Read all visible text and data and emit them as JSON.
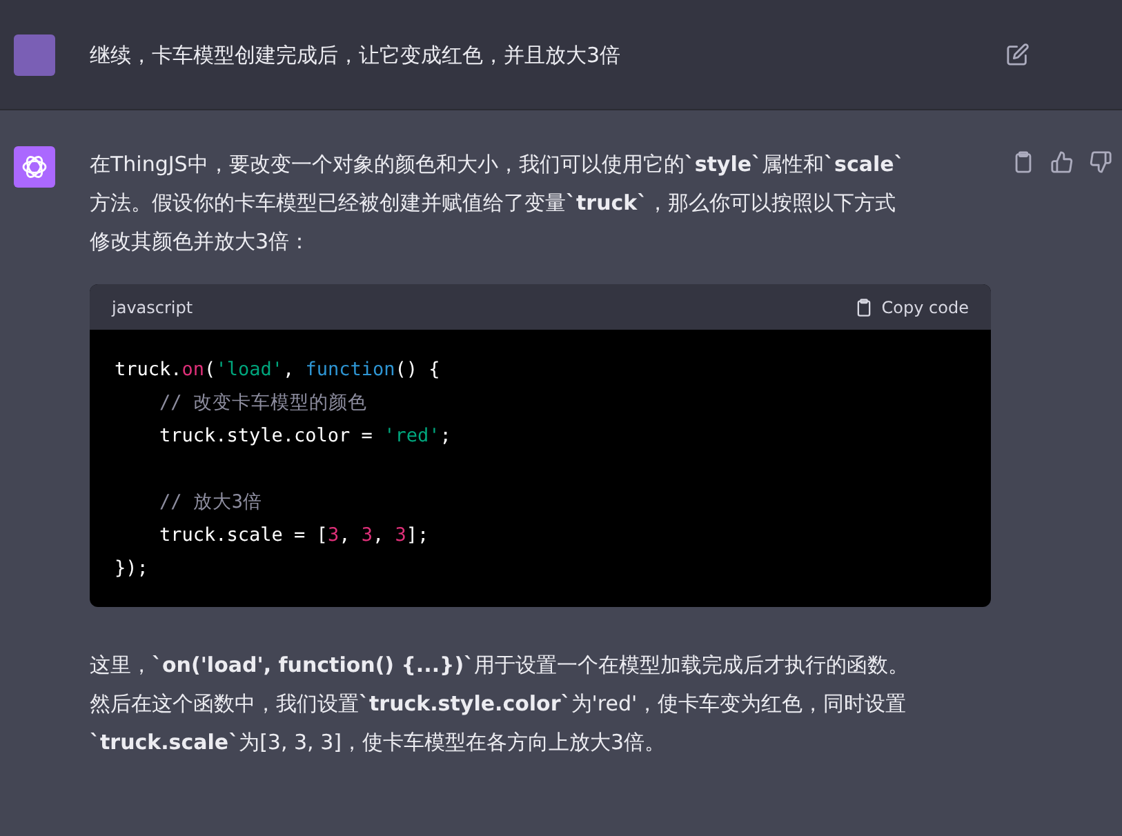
{
  "user_message": {
    "text": "继续，卡车模型创建完成后，让它变成红色，并且放大3倍"
  },
  "assistant_message": {
    "paragraphs": [
      "在ThingJS中，要改变一个对象的颜色和大小，我们可以使用它的**`style`**属性和**`scale`**方法。假设你的卡车模型已经被创建并赋值给了变量**`truck`**，那么你可以按照以下方式修改其颜色并放大3倍："
    ],
    "code_block": {
      "language": "javascript",
      "copy_label": "Copy code",
      "lines": [
        [
          {
            "kind": "plain",
            "text": "truck."
          },
          {
            "kind": "fn",
            "text": "on"
          },
          {
            "kind": "plain",
            "text": "("
          },
          {
            "kind": "str",
            "text": "'load'"
          },
          {
            "kind": "plain",
            "text": ", "
          },
          {
            "kind": "kw",
            "text": "function"
          },
          {
            "kind": "plain",
            "text": "() {"
          }
        ],
        [
          {
            "kind": "comment",
            "text": "    // 改变卡车模型的颜色"
          }
        ],
        [
          {
            "kind": "plain",
            "text": "    truck.style.color = "
          },
          {
            "kind": "str",
            "text": "'red'"
          },
          {
            "kind": "plain",
            "text": ";"
          }
        ],
        [
          {
            "kind": "blank"
          }
        ],
        [
          {
            "kind": "comment",
            "text": "    // 放大3倍"
          }
        ],
        [
          {
            "kind": "plain",
            "text": "    truck.scale = ["
          },
          {
            "kind": "num",
            "text": "3"
          },
          {
            "kind": "plain",
            "text": ", "
          },
          {
            "kind": "num",
            "text": "3"
          },
          {
            "kind": "plain",
            "text": ", "
          },
          {
            "kind": "num",
            "text": "3"
          },
          {
            "kind": "plain",
            "text": "];"
          }
        ],
        [
          {
            "kind": "plain",
            "text": "});"
          }
        ]
      ]
    },
    "closing_paragraphs": [
      "这里，**`on('load', function() {...})`**用于设置一个在模型加载完成后才执行的函数。然后在这个函数中，我们设置**`truck.style.color`**为'red'，使卡车变为红色，同时设置**`truck.scale`**为[3, 3, 3]，使卡车模型在各方向上放大3倍。"
    ]
  }
}
